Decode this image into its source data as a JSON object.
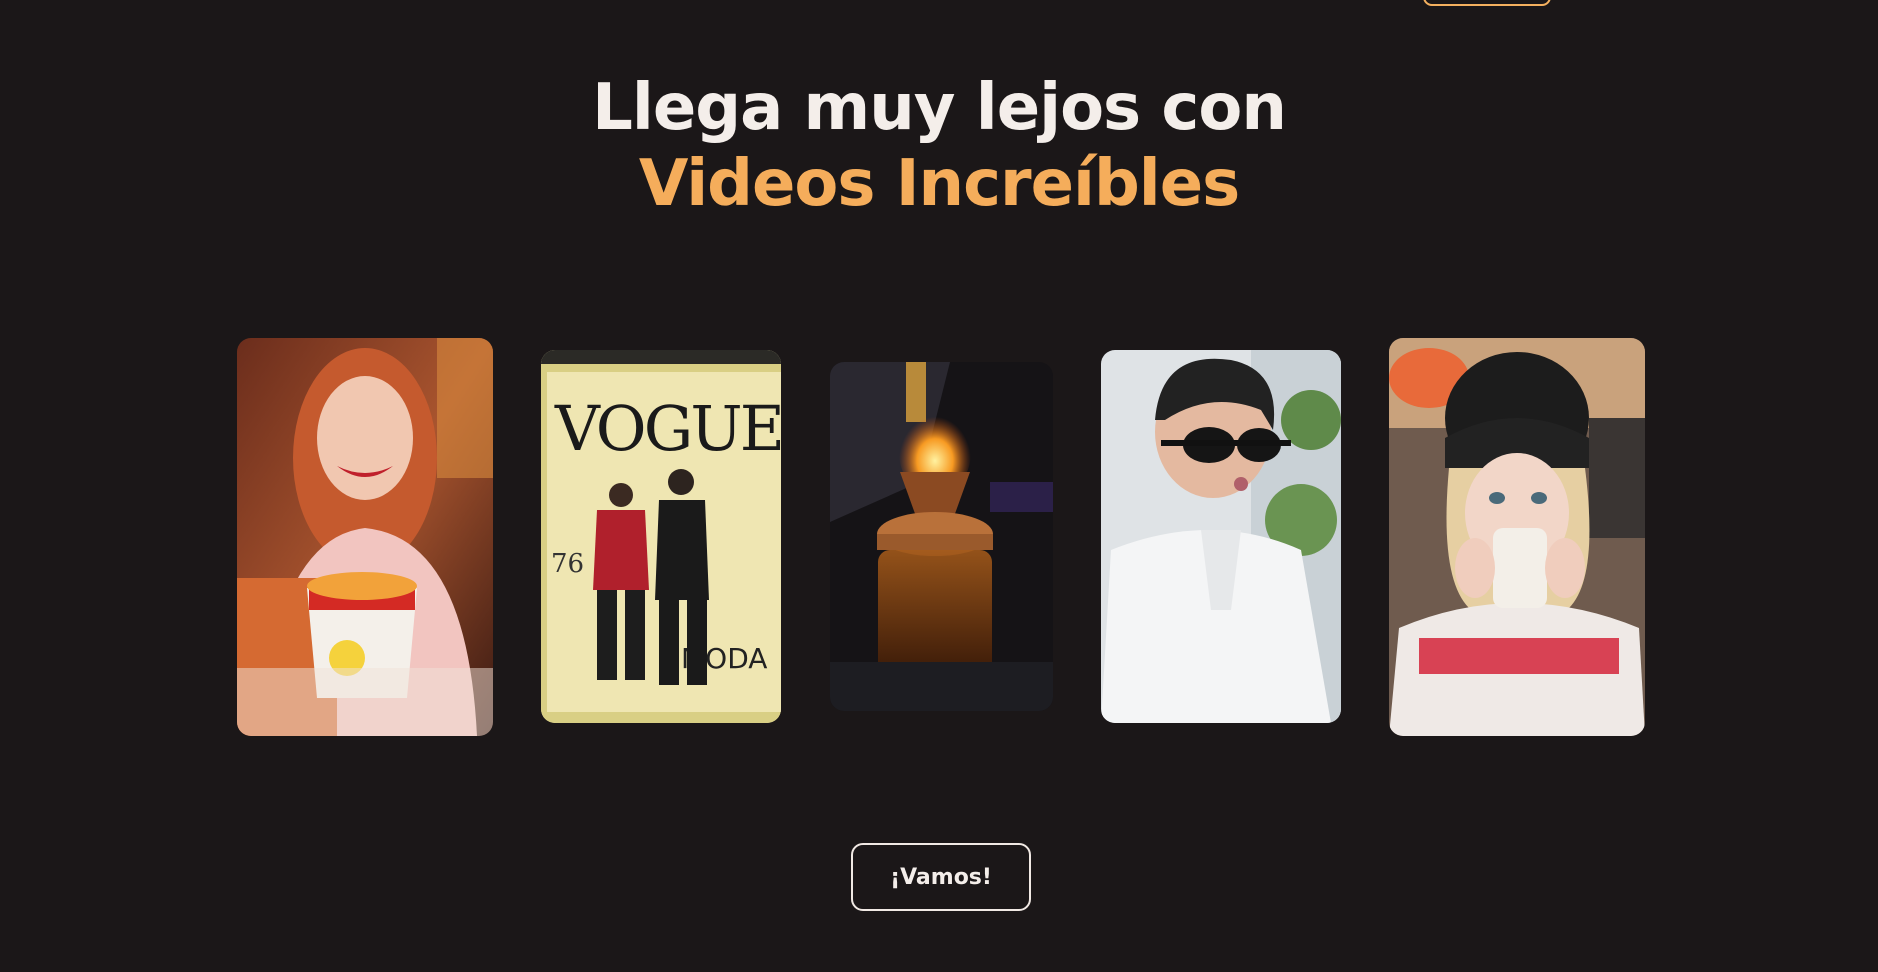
{
  "header": {
    "title_line_1": "Llega muy lejos con",
    "title_line_2": "Videos Increíbles"
  },
  "videos": [
    {
      "name": "Mujer comiendo helado en vaso de Pokémon"
    },
    {
      "name": "Dos hombres posando frente a portada de revista"
    },
    {
      "vogue_text": "VOGUE",
      "moda_text": "MODA",
      "number_text": "76"
    },
    {
      "name": "Cóctel ahumado con soplete"
    },
    {
      "name": "Hombre con lentes de sol soplando"
    },
    {
      "name": "Mujer con gorro bebiendo de taza"
    }
  ],
  "cover": {
    "vogue_text": "VOGUE",
    "moda_text": "MODA",
    "number_text": "76"
  },
  "cta": {
    "label": "¡Vamos!"
  },
  "colors": {
    "background": "#1b1718",
    "accent": "#f5ad5b",
    "text": "#f4eeea"
  }
}
